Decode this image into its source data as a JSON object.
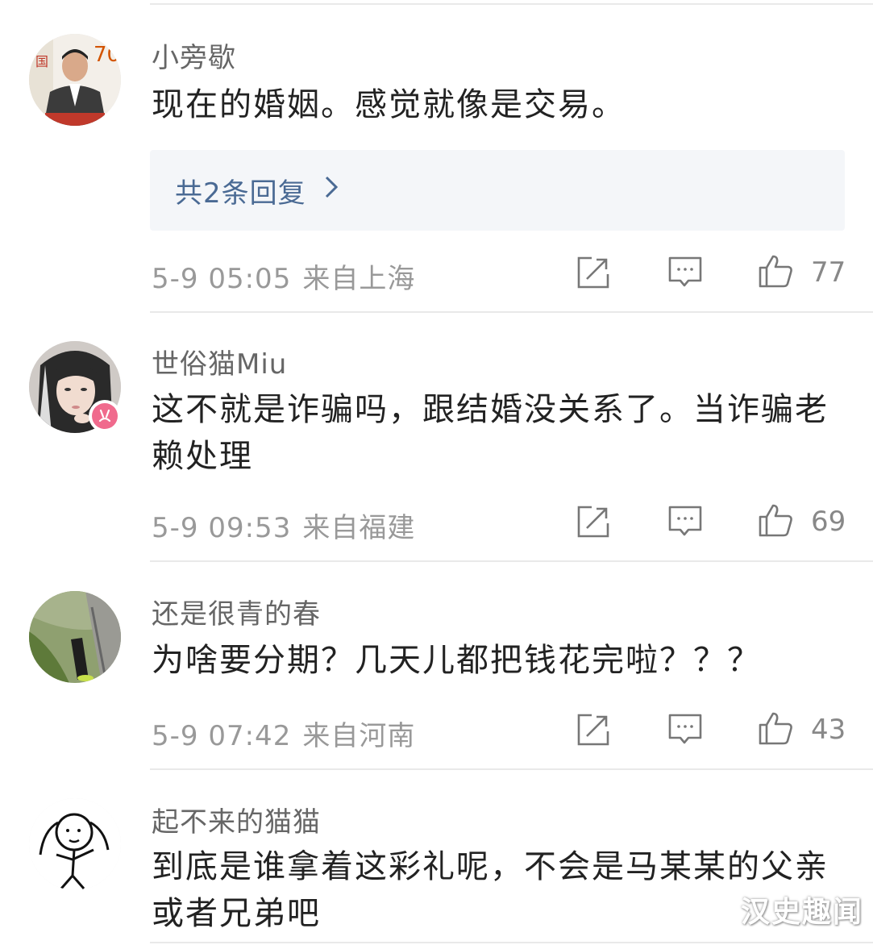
{
  "comments": [
    {
      "username": "小旁歇",
      "text": "现在的婚姻。感觉就像是交易。",
      "replies_label": "共2条回复",
      "time": "5-9 05:05",
      "location": "来自上海",
      "likes": "77"
    },
    {
      "username": "世俗猫Miu",
      "text": "这不就是诈骗吗，跟结婚没关系了。当诈骗老赖处理",
      "time": "5-9 09:53",
      "location": "来自福建",
      "likes": "69"
    },
    {
      "username": "还是很青的春",
      "text": "为啥要分期？几天儿都把钱花完啦？？？",
      "time": "5-9 07:42",
      "location": "来自河南",
      "likes": "43"
    },
    {
      "username": "起不来的猫猫",
      "text": "到底是谁拿着这彩礼呢，不会是马某某的父亲或者兄弟吧"
    }
  ],
  "watermark": "汉史趣闻",
  "icons": {
    "share": "share-icon",
    "comment": "comment-icon",
    "like": "thumbs-up-icon",
    "chevron": "chevron-right-icon",
    "badge": "vip-badge-icon"
  },
  "colors": {
    "reply_link": "#4a6a94",
    "reply_bg": "#f4f6f9",
    "meta": "#999999",
    "badge": "#f06a8d"
  }
}
